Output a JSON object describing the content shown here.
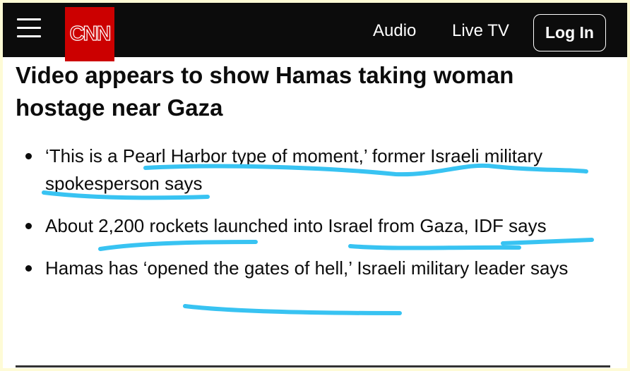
{
  "nav": {
    "logo": "CNN",
    "links": [
      "Audio",
      "Live TV"
    ],
    "login_label": "Log In"
  },
  "article": {
    "headline": "Video appears to show Hamas taking woman hostage near Gaza",
    "bullets": [
      "‘This is a Pearl Harbor type of moment,’ former Israeli military spokesperson says",
      "About 2,200 rockets launched into Israel from Gaza, IDF says",
      "Hamas has ‘opened the gates of hell,’ Israeli military leader says"
    ]
  },
  "colors": {
    "nav_bg": "#0c0c0c",
    "brand_red": "#cc0000",
    "highlight_marker": "#38c3f2",
    "page_border": "#fefbd6"
  }
}
